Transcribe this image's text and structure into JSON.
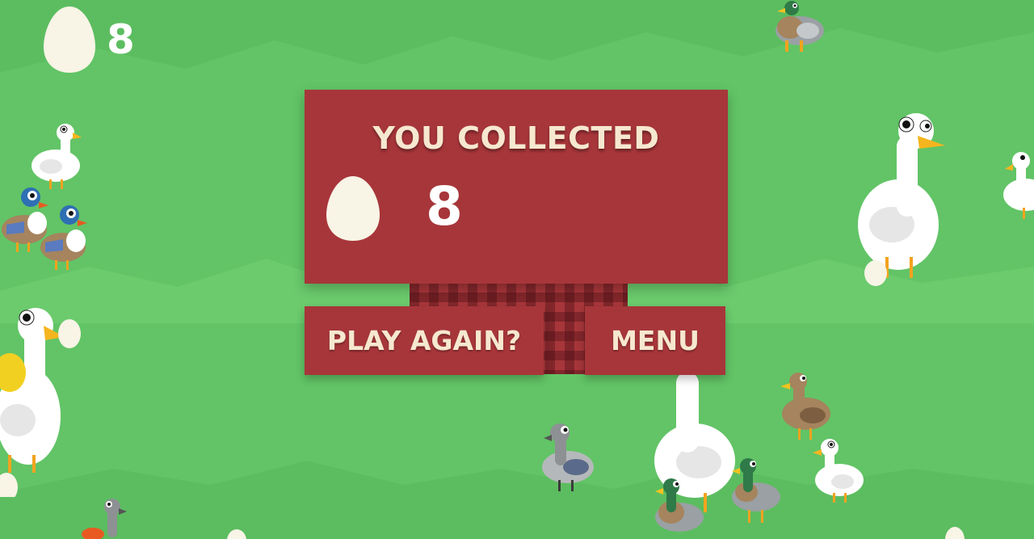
{
  "hud": {
    "egg_count": "8",
    "egg_icon": "egg-icon"
  },
  "results": {
    "title": "YOU COLLECTED",
    "egg_count": "8",
    "egg_icon": "egg-icon"
  },
  "buttons": {
    "play_again_label": "PLAY AGAIN?",
    "menu_label": "MENU"
  },
  "colors": {
    "grass": "#62c466",
    "panel": "#a7363a",
    "egg": "#f8f4e6",
    "title_text": "#f6e8d0"
  }
}
